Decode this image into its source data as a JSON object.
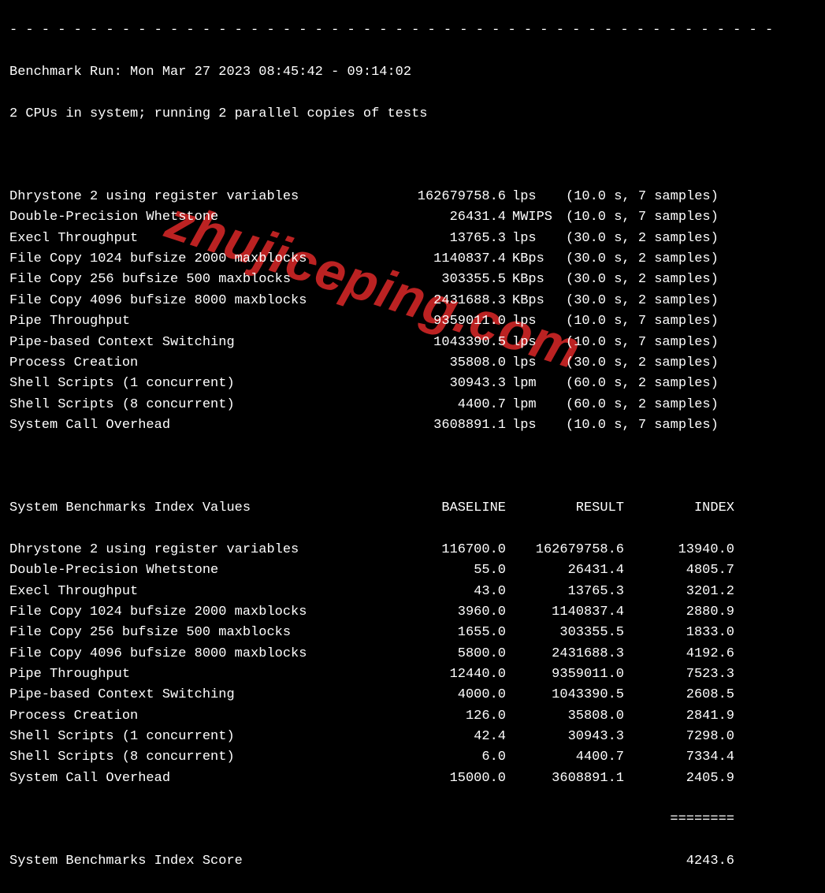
{
  "divider_top": "- - - - - - - - - - - - - - - - - - - - - - - - - - - - - - - - - - - - - - - - - - - - - - - -",
  "header_line1": "Benchmark Run: Mon Mar 27 2023 08:45:42 - 09:14:02",
  "header_line2": "2 CPUs in system; running 2 parallel copies of tests",
  "watermark": "zhujiceping.com",
  "tests": [
    {
      "name": "Dhrystone 2 using register variables",
      "value": "162679758.6",
      "unit": "lps",
      "sample": "(10.0 s, 7 samples)"
    },
    {
      "name": "Double-Precision Whetstone",
      "value": "26431.4",
      "unit": "MWIPS",
      "sample": "(10.0 s, 7 samples)"
    },
    {
      "name": "Execl Throughput",
      "value": "13765.3",
      "unit": "lps",
      "sample": "(30.0 s, 2 samples)"
    },
    {
      "name": "File Copy 1024 bufsize 2000 maxblocks",
      "value": "1140837.4",
      "unit": "KBps",
      "sample": "(30.0 s, 2 samples)"
    },
    {
      "name": "File Copy 256 bufsize 500 maxblocks",
      "value": "303355.5",
      "unit": "KBps",
      "sample": "(30.0 s, 2 samples)"
    },
    {
      "name": "File Copy 4096 bufsize 8000 maxblocks",
      "value": "2431688.3",
      "unit": "KBps",
      "sample": "(30.0 s, 2 samples)"
    },
    {
      "name": "Pipe Throughput",
      "value": "9359011.0",
      "unit": "lps",
      "sample": "(10.0 s, 7 samples)"
    },
    {
      "name": "Pipe-based Context Switching",
      "value": "1043390.5",
      "unit": "lps",
      "sample": "(10.0 s, 7 samples)"
    },
    {
      "name": "Process Creation",
      "value": "35808.0",
      "unit": "lps",
      "sample": "(30.0 s, 2 samples)"
    },
    {
      "name": "Shell Scripts (1 concurrent)",
      "value": "30943.3",
      "unit": "lpm",
      "sample": "(60.0 s, 2 samples)"
    },
    {
      "name": "Shell Scripts (8 concurrent)",
      "value": "4400.7",
      "unit": "lpm",
      "sample": "(60.0 s, 2 samples)"
    },
    {
      "name": "System Call Overhead",
      "value": "3608891.1",
      "unit": "lps",
      "sample": "(10.0 s, 7 samples)"
    }
  ],
  "index_header": {
    "title": "System Benchmarks Index Values",
    "baseline": "BASELINE",
    "result": "RESULT",
    "index": "INDEX"
  },
  "index_rows": [
    {
      "name": "Dhrystone 2 using register variables",
      "baseline": "116700.0",
      "result": "162679758.6",
      "index": "13940.0"
    },
    {
      "name": "Double-Precision Whetstone",
      "baseline": "55.0",
      "result": "26431.4",
      "index": "4805.7"
    },
    {
      "name": "Execl Throughput",
      "baseline": "43.0",
      "result": "13765.3",
      "index": "3201.2"
    },
    {
      "name": "File Copy 1024 bufsize 2000 maxblocks",
      "baseline": "3960.0",
      "result": "1140837.4",
      "index": "2880.9"
    },
    {
      "name": "File Copy 256 bufsize 500 maxblocks",
      "baseline": "1655.0",
      "result": "303355.5",
      "index": "1833.0"
    },
    {
      "name": "File Copy 4096 bufsize 8000 maxblocks",
      "baseline": "5800.0",
      "result": "2431688.3",
      "index": "4192.6"
    },
    {
      "name": "Pipe Throughput",
      "baseline": "12440.0",
      "result": "9359011.0",
      "index": "7523.3"
    },
    {
      "name": "Pipe-based Context Switching",
      "baseline": "4000.0",
      "result": "1043390.5",
      "index": "2608.5"
    },
    {
      "name": "Process Creation",
      "baseline": "126.0",
      "result": "35808.0",
      "index": "2841.9"
    },
    {
      "name": "Shell Scripts (1 concurrent)",
      "baseline": "42.4",
      "result": "30943.3",
      "index": "7298.0"
    },
    {
      "name": "Shell Scripts (8 concurrent)",
      "baseline": "6.0",
      "result": "4400.7",
      "index": "7334.4"
    },
    {
      "name": "System Call Overhead",
      "baseline": "15000.0",
      "result": "3608891.1",
      "index": "2405.9"
    }
  ],
  "divider_equals": "========",
  "score_label": "System Benchmarks Index Score",
  "score_value": "4243.6"
}
